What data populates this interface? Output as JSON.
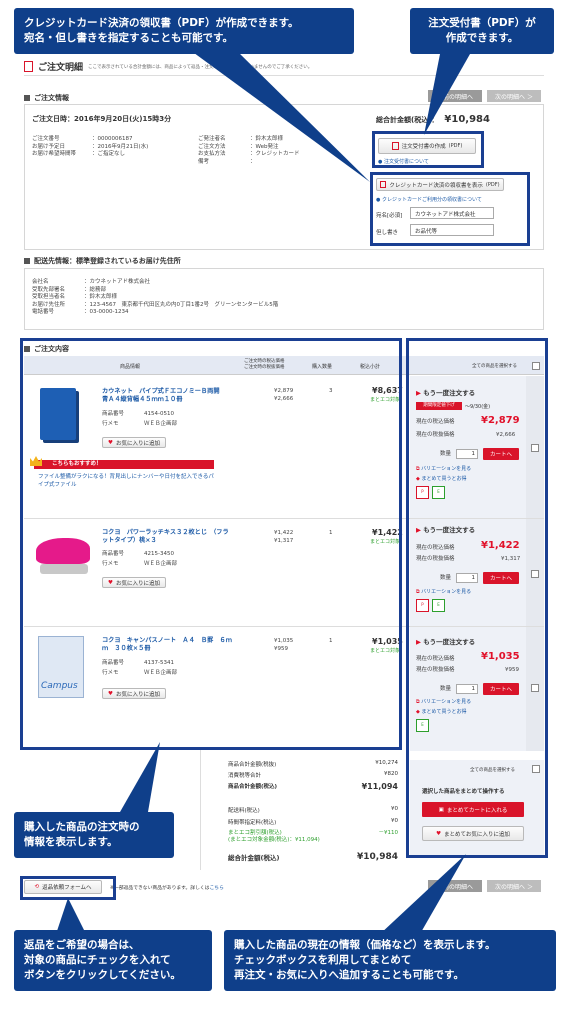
{
  "callouts": {
    "top_left": "クレジットカード決済の領収書（PDF）が作成できます。\n宛名・但し書きを指定することも可能です。",
    "top_right": "注文受付書（PDF）が\n作成できます。",
    "mid_left": "購入した商品の注文時の\n情報を表示します。",
    "bottom_left": "返品をご希望の場合は、\n対象の商品にチェックを入れて\nボタンをクリックしてください。",
    "bottom_right": "購入した商品の現在の情報（価格など）を表示します。\nチェックボックスを利用してまとめて\n再注文・お気に入りへ追加することも可能です。"
  },
  "header": {
    "title": "ご注文明細",
    "note": "ここで表示されている合計金額には、商品によって返品・注文取消が反映されていませんのでご了承ください。",
    "prev_btn": "＜前の明細へ",
    "next_btn": "次の明細へ ＞"
  },
  "order_info": {
    "section": "ご注文情報",
    "datetime": "ご注文日時：2016年9月20日(火)15時3分",
    "total_label": "総合計金額(税込)：",
    "total_value": "¥10,984",
    "left_labels": "ご注文番号\nお届け予定日\nお届け希望時間帯",
    "left_values": "：0000006187\n：2016年9月21日(水)\n：ご指定なし",
    "right_labels": "ご発注者名\nご注文方法\nお支払方法\n備考",
    "right_values": "：鈴木太郎様\n：Web発注\n：クレジットカード\n：",
    "receipt_btn": "注文受付書の作成",
    "pdf": "(PDF)",
    "receipt_link": "注文受付書について",
    "cc_btn": "クレジットカード決済の領収書を表示",
    "cc_link": "クレジットカードご利用分の領収書について",
    "atena_label": "宛名[必須]",
    "atena_value": "カウネットアド株式会社",
    "tadashi_label": "但し書き",
    "tadashi_value": "お品代等"
  },
  "delivery": {
    "section": "配送先情報：標準登録されているお届け先住所",
    "labels": "会社名\n受取先部署名\n受取担当者名\nお届け先住所\n電話番号",
    "values": "：カウネットアド株式会社\n：総務部\n：鈴木太郎様\n：123-4567　東京都千代田区丸の内0丁目1番2号　グリーンセンタービル5階\n：03-0000-1234"
  },
  "contents": {
    "section": "ご注文内容",
    "col_product": "商品情報",
    "col_price": "ご注文時の税込価格\nご注文時の税抜価格",
    "col_qty": "購入数量",
    "col_subtotal": "税込小計",
    "select_all": "全ての商品を選択する",
    "reorder": "もう一度注文する",
    "now_tax": "現在の税込価格",
    "now_notax": "現在の税抜価格",
    "qty_label": "数量",
    "cart_btn": "カートへ",
    "variation": "バリエーションを見る",
    "matome": "まとめて買うとお得",
    "fav_btn": "お気に入りに追加",
    "eco": "まとエコ対象"
  },
  "items": [
    {
      "name": "カウネット　パイプ式ＦエコノミーＢ両開　青Ａ４縦背幅４５ｍｍ１０冊",
      "code_label": "商品番号",
      "code": "4154-0510",
      "memo_label": "行メモ",
      "memo": "ＷＥＢ企画部",
      "price_tax": "¥2,879",
      "price_notax": "¥2,666",
      "qty": "3",
      "subtotal": "¥8,637",
      "now_tax": "¥2,879",
      "now_notax": "¥2,666",
      "sale": "期間限定値下げ",
      "sale_date": "～9/30(金)",
      "qty_input": "1",
      "recommend_title": "こちらもおすすめ！",
      "recommend_text": "ファイル整備がラクになる！背見出しにナンバーや日付を記入できるパイプ式ファイル"
    },
    {
      "name": "コクヨ　パワーラッチキス３２枚とじ　（フラットタイプ）桃×３",
      "code_label": "商品番号",
      "code": "4215-3450",
      "memo_label": "行メモ",
      "memo": "ＷＥＢ企画部",
      "price_tax": "¥1,422",
      "price_notax": "¥1,317",
      "qty": "1",
      "subtotal": "¥1,422",
      "now_tax": "¥1,422",
      "now_notax": "¥1,317",
      "qty_input": "1"
    },
    {
      "name": "コクヨ　キャンパスノート　Ａ４　Ｂ罫　６ｍｍ　３０枚×５冊",
      "code_label": "商品番号",
      "code": "4137-5341",
      "memo_label": "行メモ",
      "memo": "ＷＥＢ企画部",
      "price_tax": "¥1,035",
      "price_notax": "¥959",
      "qty": "1",
      "subtotal": "¥1,035",
      "now_tax": "¥1,035",
      "now_notax": "¥959",
      "qty_input": "1"
    }
  ],
  "summary": {
    "r1_label": "商品合計金額(税抜)",
    "r1_value": "¥10,274",
    "r2_label": "消費税等合計",
    "r2_value": "¥820",
    "r3_label": "商品合計金額(税込)",
    "r3_value": "¥11,094",
    "r4_label": "配送料(税込)",
    "r4_value": "¥0",
    "r5_label": "時間帯指定料(税込)",
    "r5_value": "¥0",
    "r6_label": "まとエコ割引額(税込)\n(まとエコ対象金額(税込)：¥11,094)",
    "r6_value": "－¥110",
    "r7_label": "総合計金額(税込)",
    "r7_value": "¥10,984"
  },
  "bulk": {
    "select_all": "全ての商品を選択する",
    "title": "選択した商品をまとめて操作する",
    "cart": "まとめてカートに入れる",
    "fav": "まとめてお気に入りに追加"
  },
  "footer": {
    "return_btn": "返品依頼フォームへ",
    "return_note": "※一部返品できない商品があります。詳しくは",
    "return_link": "こちら",
    "prev_btn": "＜前の明細へ",
    "next_btn": "次の明細へ ＞"
  },
  "product_texts": {
    "campus": "Campus"
  }
}
